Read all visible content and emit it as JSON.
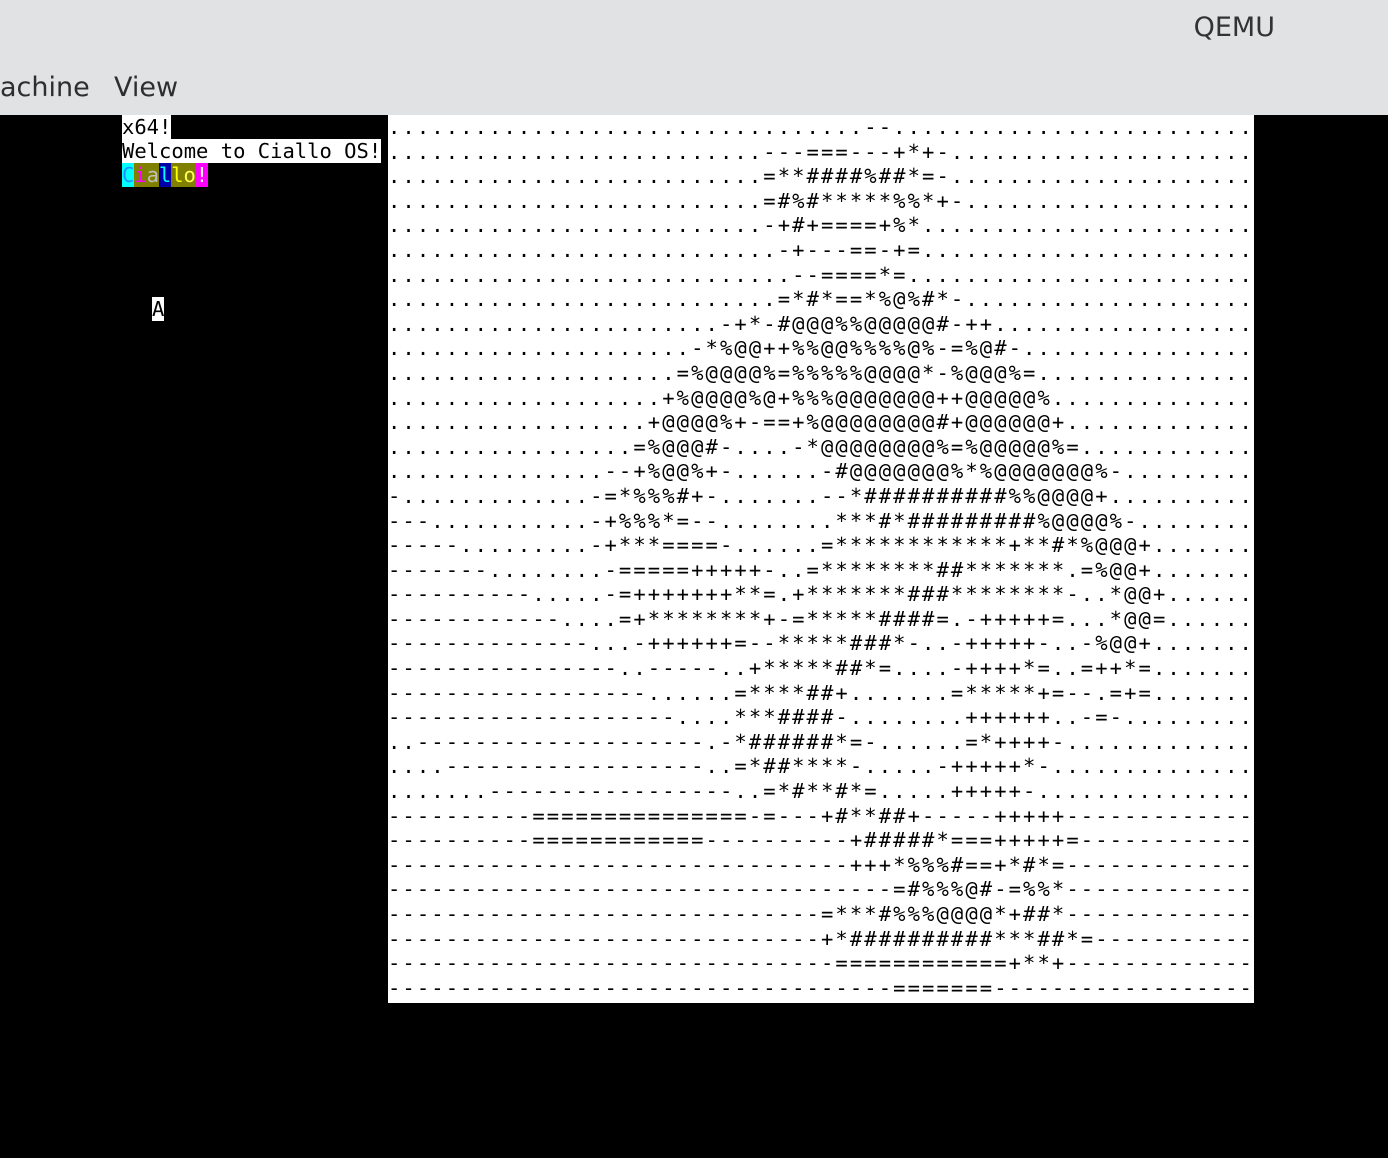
{
  "window": {
    "title": "QEMU"
  },
  "menubar": {
    "items": [
      "achine",
      "View"
    ]
  },
  "console": {
    "line0": "x64!",
    "line1": "Welcome to Ciallo OS!",
    "ciallo": [
      {
        "ch": "C",
        "fg": "#1e90ff",
        "bg": "#00ffff"
      },
      {
        "ch": "i",
        "fg": "#ff00ff",
        "bg": "#808000"
      },
      {
        "ch": "a",
        "fg": "#c0c0c0",
        "bg": "#808000"
      },
      {
        "ch": "l",
        "fg": "#00ffff",
        "bg": "#0000aa"
      },
      {
        "ch": "l",
        "fg": "#ffff00",
        "bg": "#808000"
      },
      {
        "ch": "o",
        "fg": "#ffff55",
        "bg": "#808000"
      },
      {
        "ch": "!",
        "fg": "#ffffff",
        "bg": "#ff00ff"
      }
    ],
    "key_echo": "A"
  },
  "ascii_art": [
    ".................................--.........................",
    "..........................---===---+*+-.....................",
    "..........................=**####%##*=-.....................",
    "..........................=#%#*****%%*+-....................",
    "..........................-+#+====+%*.......................",
    "...........................-+---==-+=.......................",
    "............................--====*=........................",
    "...........................=*#*==*%@%#*-....................",
    ".......................-+*-#@@@%%@@@@@#-++..................",
    ".....................-*%@@++%%@@%%%%@%-=%@#-................",
    "....................=%@@@@%=%%%%%@@@@*-%@@@%=...............",
    "...................+%@@@@%@+%%%@@@@@@@++@@@@@%..............",
    "..................+@@@@%+-==+%@@@@@@@@#+@@@@@@+.............",
    ".................=%@@@#-....-*@@@@@@@@%=%@@@@@%=............",
    "...............--+%@@%+-......-#@@@@@@@%*%@@@@@@@%-.........",
    "-.............-=*%%%#+-.......--*##########%%@@@@+..........",
    "---...........-+%%%*=--........***#*#########%@@@@%-........",
    "-----.........-+***====-......=************+**#*%@@@+.......",
    "-------........-=====+++++-..=********##*******.=%@@+.......",
    "----------.....-=+++++++**=.+*******###********-..*@@+......",
    "------------....=+********+-=*****####=.-+++++=...*@@=......",
    "--------------...-++++++=--*****###*-..-+++++-..-%@@+.......",
    "----------------..-----..+*****##*=....-++++*=..=++*=.......",
    "------------------......=****##+.......=*****+=--.=+=.......",
    "--------------------....***####-........++++++..-=-.........",
    "..--------------------.-*######*=-......=*++++-.............",
    "....------------------..=*##****-.....-+++++*-..............",
    ".......-----------------..=*#**#*=.....+++++-...............",
    "----------===============-=---+#**##+-----+++++-------------",
    "----------============----------+#####*===+++++=------------",
    "--------------------------------+++*%%%#==+*#*=-------------",
    "-----------------------------------=#%%%@#-=%%*-------------",
    "------------------------------=***#%%%@@@@*+##*-------------",
    "------------------------------+*##########***##*=-----------",
    "-------------------------------============+**+-------------",
    "-----------------------------------=======------------------"
  ]
}
